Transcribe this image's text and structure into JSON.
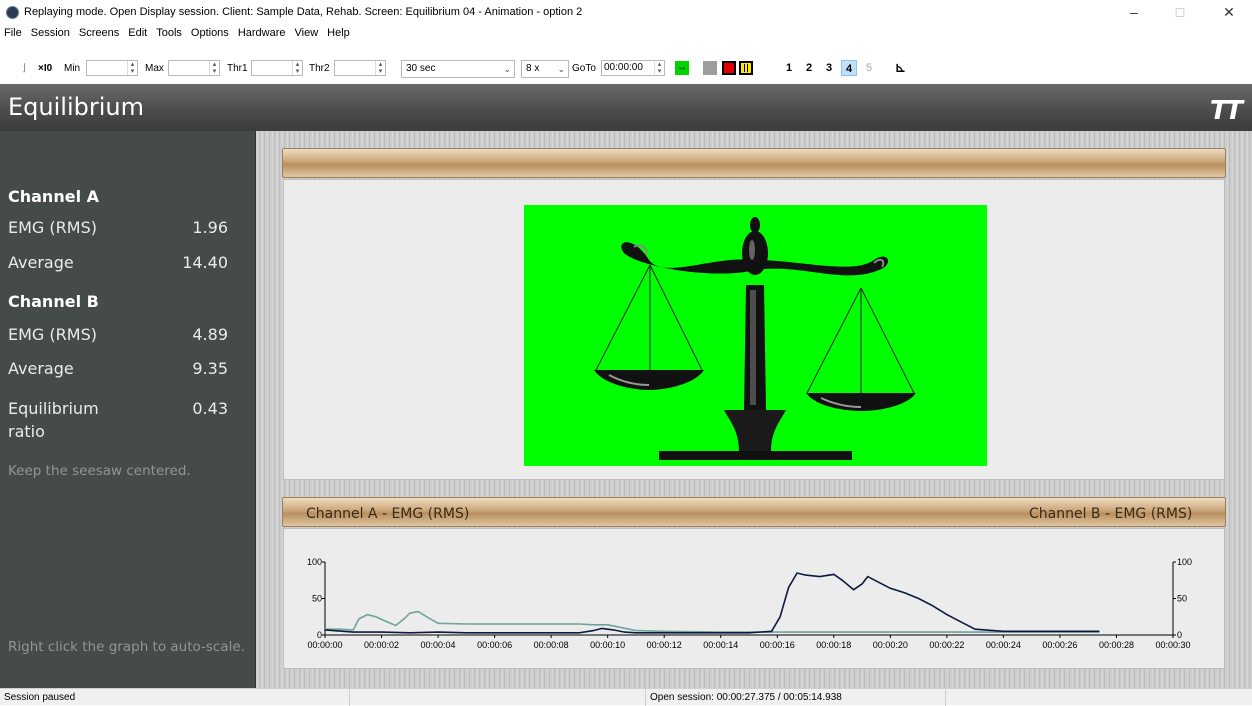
{
  "window": {
    "title": "Replaying mode. Open Display session. Client: Sample Data, Rehab. Screen: Equilibrium 04 - Animation - option 2",
    "min": "–",
    "max": "□",
    "close": "✕"
  },
  "menu": [
    "File",
    "Session",
    "Screens",
    "Edit",
    "Tools",
    "Options",
    "Hardware",
    "View",
    "Help"
  ],
  "toolbar": {
    "x10": "×I0",
    "min_label": "Min",
    "max_label": "Max",
    "thr1_label": "Thr1",
    "thr2_label": "Thr2",
    "duration": "30 sec",
    "speed": "8 x",
    "goto_label": "GoTo",
    "goto_value": "00:00:00",
    "screens": [
      "1",
      "2",
      "3",
      "4",
      "5"
    ],
    "active_screen": "4"
  },
  "header": {
    "title": "Equilibrium",
    "logo": "TT"
  },
  "sidebar": {
    "channel_a": "Channel A",
    "a_emg_label": "EMG (RMS)",
    "a_emg_value": "1.96",
    "a_avg_label": "Average",
    "a_avg_value": "14.40",
    "channel_b": "Channel B",
    "b_emg_label": "EMG (RMS)",
    "b_emg_value": "4.89",
    "b_avg_label": "Average",
    "b_avg_value": "9.35",
    "ratio_label_1": "Equilibrium",
    "ratio_label_2": "ratio",
    "ratio_value": "0.43",
    "instruction": "Keep the seesaw centered.",
    "hint": "Right click the graph to auto-scale."
  },
  "graph": {
    "left_title": "Channel A - EMG (RMS)",
    "right_title": "Channel B - EMG (RMS)"
  },
  "chart_data": {
    "type": "line",
    "title": "",
    "xlabel": "",
    "ylabel": "",
    "xlim": [
      0,
      30
    ],
    "ylim": [
      0,
      100
    ],
    "x_ticks": [
      "00:00:00",
      "00:00:02",
      "00:00:04",
      "00:00:06",
      "00:00:08",
      "00:00:10",
      "00:00:12",
      "00:00:14",
      "00:00:16",
      "00:00:18",
      "00:00:20",
      "00:00:22",
      "00:00:24",
      "00:00:26",
      "00:00:28",
      "00:00:30"
    ],
    "y_ticks_left": [
      "0",
      "50",
      "100"
    ],
    "y_ticks_right": [
      "0",
      "50",
      "100"
    ],
    "series": [
      {
        "color": "#6fa39b",
        "x": [
          0,
          0.5,
          1,
          1.2,
          1.5,
          1.8,
          2.2,
          2.5,
          2.8,
          3.0,
          3.3,
          3.6,
          4.0,
          5,
          6,
          7,
          8,
          9,
          9.5,
          10,
          10.5,
          11,
          12,
          14,
          16,
          18,
          20,
          22,
          24,
          26,
          27.4
        ],
        "y": [
          8,
          8,
          7,
          22,
          28,
          25,
          18,
          13,
          22,
          30,
          32,
          25,
          16,
          15,
          15,
          15,
          15,
          15,
          14,
          14,
          10,
          6,
          5,
          4,
          4,
          4,
          4,
          4,
          4,
          4,
          4
        ]
      },
      {
        "color": "#0d1a40",
        "x": [
          0,
          1,
          2,
          3,
          4,
          5,
          6,
          7,
          8,
          9,
          9.5,
          9.8,
          10.2,
          10.6,
          11,
          12,
          14,
          15,
          15.8,
          16.1,
          16.4,
          16.7,
          17,
          17.5,
          18,
          18.3,
          18.7,
          19,
          19.2,
          19.6,
          20,
          20.5,
          21,
          21.5,
          22,
          22.5,
          23,
          24,
          26,
          27.4
        ],
        "y": [
          7,
          4,
          4,
          3,
          4,
          3,
          3,
          3,
          3,
          3,
          6,
          9,
          7,
          4,
          3,
          3,
          3,
          3,
          5,
          25,
          65,
          85,
          82,
          80,
          83,
          75,
          62,
          70,
          80,
          72,
          64,
          58,
          50,
          40,
          28,
          18,
          8,
          5,
          5,
          5
        ]
      }
    ]
  }
}
